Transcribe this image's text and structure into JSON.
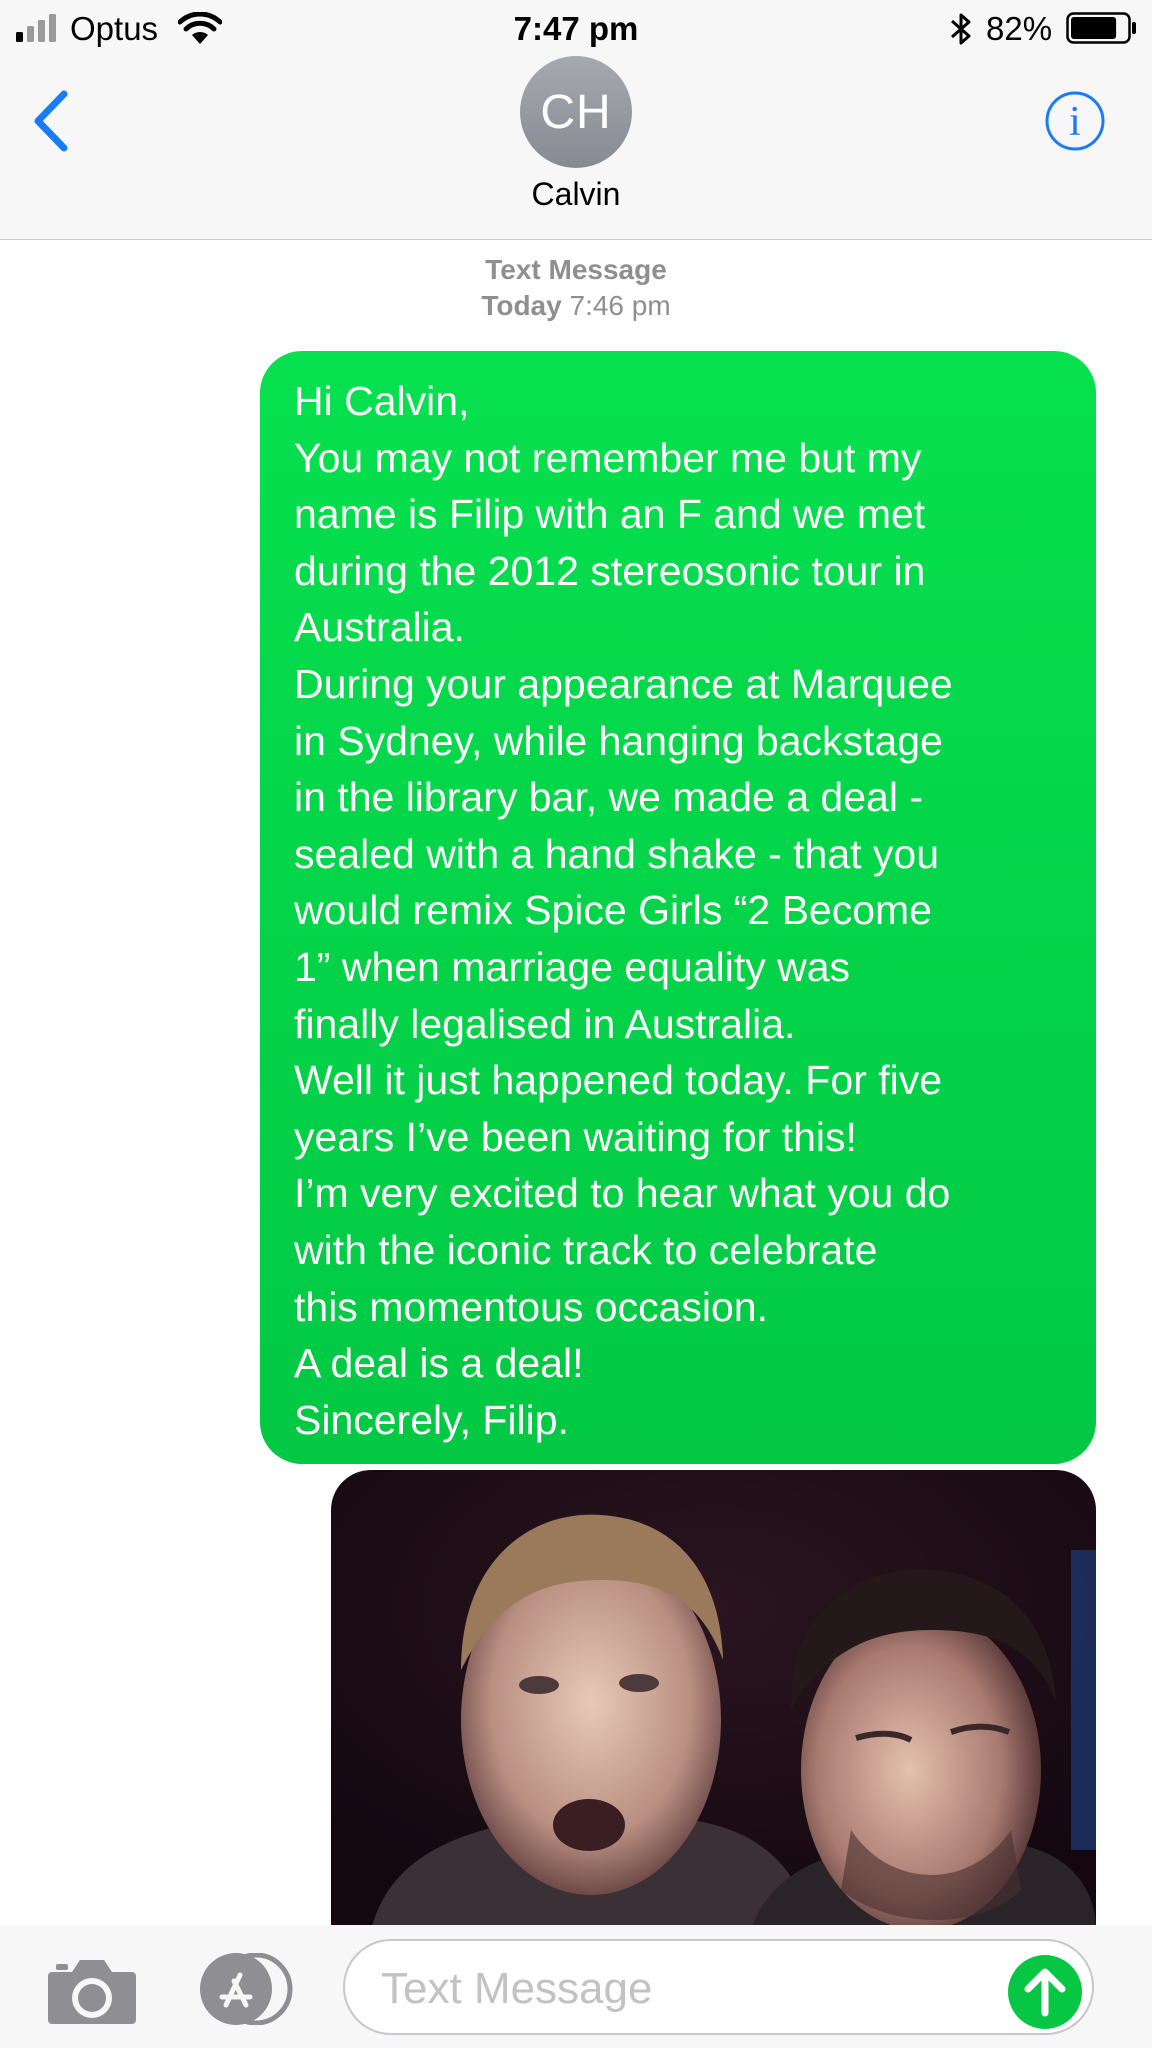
{
  "status_bar": {
    "carrier": "Optus",
    "time": "7:47 pm",
    "battery_percent": "82%",
    "battery_level": 0.82,
    "icons": [
      "signal-icon",
      "wifi-icon",
      "bluetooth-icon",
      "battery-icon"
    ]
  },
  "header": {
    "avatar_initials": "CH",
    "contact_name": "Calvin",
    "back_icon": "chevron-left-icon",
    "info_icon": "info-icon",
    "accent_color": "#1a7cf5"
  },
  "conversation": {
    "service_label": "Text Message",
    "day_label": "Today",
    "time_label": "7:46 pm",
    "message": {
      "lines": [
        "Hi Calvin,",
        "You may not remember me but my",
        "name is Filip with an F and we met",
        "during the 2012 stereosonic tour in",
        "Australia.",
        "During your appearance at Marquee",
        "in Sydney, while hanging backstage",
        "in the library bar, we made a deal -",
        "sealed with a hand shake - that you",
        "would remix Spice Girls “2 Become",
        "1” when marriage equality was",
        "finally legalised in Australia.",
        "Well it just happened today. For five",
        "years I’ve been waiting for this!",
        "I’m very excited to hear what you do",
        "with the iconic track to celebrate",
        "this momentous occasion.",
        "A deal is a deal!",
        "Sincerely, Filip."
      ],
      "bubble_color": "#02d44a"
    },
    "attachment": "photo"
  },
  "composer": {
    "placeholder": "Text Message",
    "camera_icon": "camera-icon",
    "apps_icon": "app-store-icon",
    "send_icon": "send-arrow-icon"
  }
}
